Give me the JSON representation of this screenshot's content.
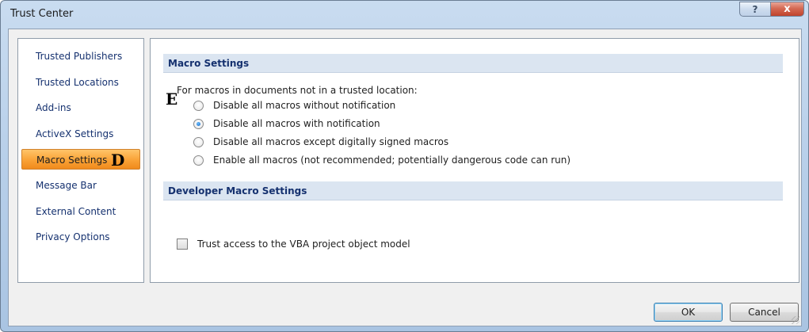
{
  "window": {
    "title": "Trust Center",
    "help_label": "?",
    "close_label": "x"
  },
  "sidebar": {
    "items": [
      {
        "label": "Trusted Publishers",
        "selected": false
      },
      {
        "label": "Trusted Locations",
        "selected": false
      },
      {
        "label": "Add-ins",
        "selected": false
      },
      {
        "label": "ActiveX Settings",
        "selected": false
      },
      {
        "label": "Macro Settings",
        "selected": true
      },
      {
        "label": "Message Bar",
        "selected": false
      },
      {
        "label": "External Content",
        "selected": false
      },
      {
        "label": "Privacy Options",
        "selected": false
      }
    ]
  },
  "annotations": {
    "d": "D",
    "e": "E"
  },
  "macro_settings": {
    "header": "Macro Settings",
    "intro": "For macros in documents not in a trusted location:",
    "options": [
      {
        "label": "Disable all macros without notification",
        "selected": false
      },
      {
        "label": "Disable all macros with notification",
        "selected": true
      },
      {
        "label": "Disable all macros except digitally signed macros",
        "selected": false
      },
      {
        "label": "Enable all macros (not recommended; potentially dangerous code can run)",
        "selected": false
      }
    ]
  },
  "developer_settings": {
    "header": "Developer Macro Settings",
    "checkbox_label": "Trust access to the VBA project object model",
    "checked": false
  },
  "buttons": {
    "ok": "OK",
    "cancel": "Cancel"
  }
}
